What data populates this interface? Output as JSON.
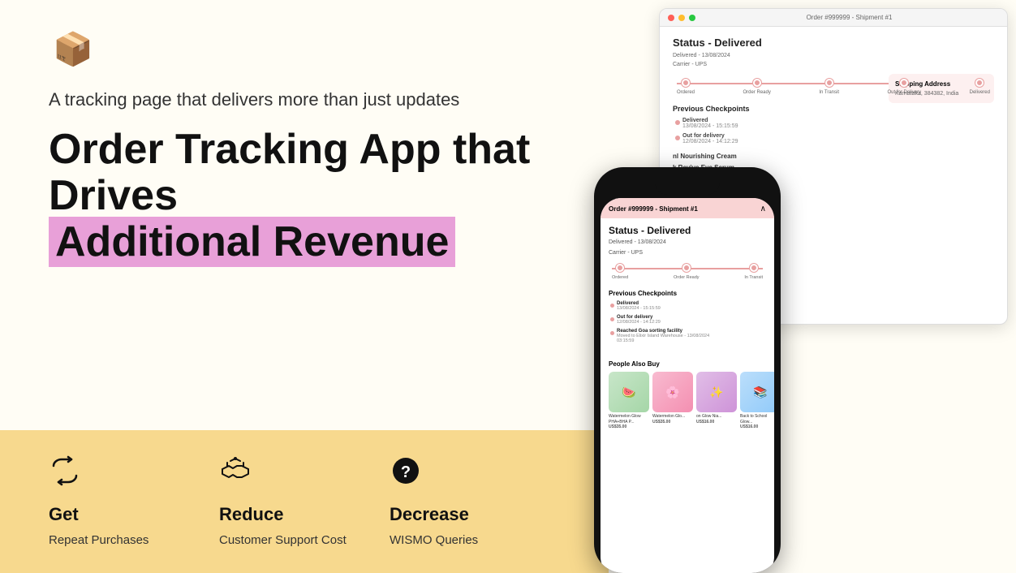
{
  "header": {
    "logo_icon": "📦",
    "tagline": "A tracking page that delivers more than just updates"
  },
  "headline": {
    "line1": "Order Tracking App that Drives",
    "line2": "Additional Revenue"
  },
  "features": [
    {
      "icon": "↩️",
      "title": "Get",
      "desc": "Repeat Purchases"
    },
    {
      "icon": "🤝",
      "title": "Reduce",
      "desc": "Customer Support Cost"
    },
    {
      "icon": "❓",
      "title": "Decrease",
      "desc": "WISMO Queries"
    }
  ],
  "desktop_mockup": {
    "titlebar": "Order #999999 - Shipment #1",
    "status": "Status - Delivered",
    "delivered_date": "Delivered - 13/08/2024",
    "carrier": "Carrier - UPS",
    "tracking_steps": [
      "Ordered",
      "Order Ready",
      "In Transit",
      "Out for Delivery",
      "Delivered"
    ],
    "prev_checkpoints_title": "Previous Checkpoints",
    "checkpoints": [
      {
        "title": "Delivered",
        "time": "13/08/2024 - 15:15:59"
      },
      {
        "title": "Out for delivery",
        "time": "12/08/2024 - 14:12:29"
      }
    ],
    "shipping_title": "Shipping Address",
    "shipping_addr": "Karnataka, 384382, India"
  },
  "phone_mockup": {
    "order_title": "Order #999999 - Shipment #1",
    "status": "Status - Delivered",
    "delivered_date": "Delivered - 13/08/2024",
    "carrier": "Carrier - UPS",
    "tracking_steps": [
      "Ordered",
      "Order Ready",
      "In Transit"
    ],
    "prev_checkpoints_title": "Previous Checkpoints",
    "checkpoints": [
      {
        "title": "Delivered",
        "time": "13/08/2024 - 15:15:59"
      },
      {
        "title": "Out for delivery",
        "time": "12/08/2024 - 14:12:29"
      },
      {
        "title": "Reached Goa sorting facility",
        "sub": "Moved to Elixir Island Warehouse - 13/08/2024",
        "time": "03:15:59"
      }
    ],
    "people_buy": "People Also Buy",
    "products": [
      {
        "name": "Watermelon Glow PHA+BHA P...",
        "price": "US$35.00",
        "color": "prod-green",
        "emoji": "🍉"
      },
      {
        "name": "Watermelon Glo...",
        "price": "US$35.00",
        "color": "prod-pink",
        "emoji": "🌸"
      },
      {
        "name": "on Glow Nia...",
        "price": "US$16.00",
        "color": "prod-purple",
        "emoji": "✨"
      },
      {
        "name": "Back to School Glow...",
        "price": "US$16.00",
        "color": "prod-blue",
        "emoji": "📚"
      }
    ]
  }
}
